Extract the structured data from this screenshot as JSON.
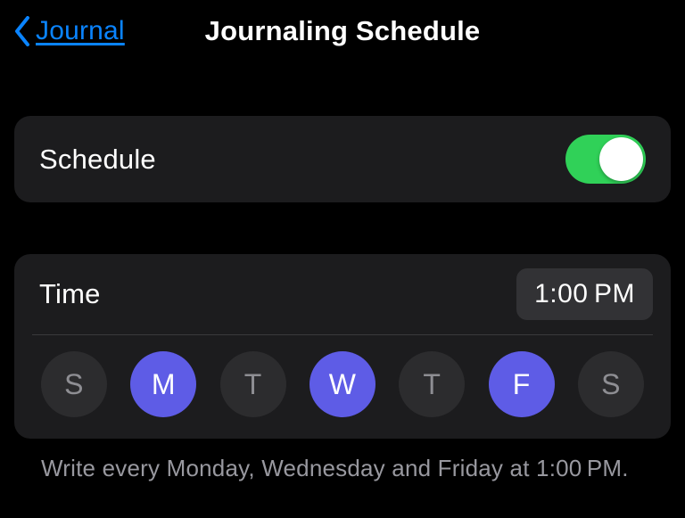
{
  "nav": {
    "back_label": "Journal",
    "title": "Journaling Schedule"
  },
  "colors": {
    "accent_link": "#0a84ff",
    "toggle_on": "#30d158",
    "day_selected": "#5e5ce6"
  },
  "schedule": {
    "label": "Schedule",
    "enabled": true
  },
  "time": {
    "label": "Time",
    "value": "1:00 PM"
  },
  "days": [
    {
      "letter": "S",
      "name": "sunday",
      "selected": false
    },
    {
      "letter": "M",
      "name": "monday",
      "selected": true
    },
    {
      "letter": "T",
      "name": "tuesday",
      "selected": false
    },
    {
      "letter": "W",
      "name": "wednesday",
      "selected": true
    },
    {
      "letter": "T",
      "name": "thursday",
      "selected": false
    },
    {
      "letter": "F",
      "name": "friday",
      "selected": true
    },
    {
      "letter": "S",
      "name": "saturday",
      "selected": false
    }
  ],
  "summary": "Write every Monday, Wednesday and Friday at 1:00 PM."
}
